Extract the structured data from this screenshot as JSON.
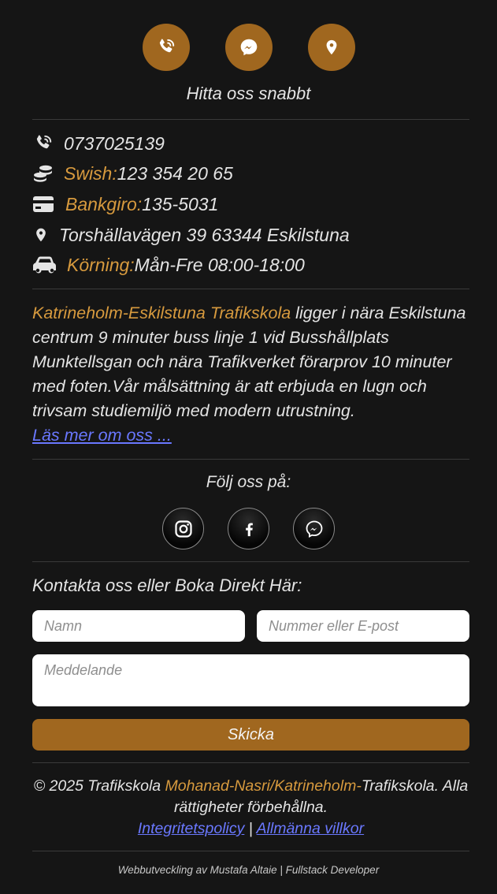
{
  "quick_links": {
    "title": "Hitta oss snabbt",
    "buttons": [
      {
        "icon": "phone-icon"
      },
      {
        "icon": "messenger-icon"
      },
      {
        "icon": "location-pin-icon"
      }
    ]
  },
  "info": {
    "phone": "0737025139",
    "swish_label": "Swish:",
    "swish_value": " 123 354 20 65",
    "bankgiro_label": "Bankgiro:",
    "bankgiro_value": " 135-5031",
    "address": "Torshällavägen 39 63344 Eskilstuna",
    "korning_label": "Körning:",
    "korning_value": " Mån-Fre 08:00-18:00"
  },
  "about": {
    "school_name": "Katrineholm-Eskilstuna Trafikskola",
    "text": " ligger i nära Eskilstuna centrum 9 minuter buss linje 1 vid Busshållplats Munktellsgan och nära Trafikverket förarprov 10 minuter med foten.Vår målsättning är att erbjuda en lugn och trivsam studiemiljö med modern utrustning.",
    "read_more": "Läs mer om oss ..."
  },
  "social": {
    "title": "Följ oss på:",
    "buttons": [
      {
        "icon": "instagram-icon"
      },
      {
        "icon": "facebook-icon"
      },
      {
        "icon": "messenger-icon"
      }
    ]
  },
  "contact": {
    "title": "Kontakta oss eller Boka Direkt Här:",
    "name_placeholder": "Namn",
    "contact_placeholder": "Nummer eller E-post",
    "message_placeholder": "Meddelande",
    "send_label": "Skicka"
  },
  "footer": {
    "copyright_prefix": "© 2025 Trafikskola ",
    "copyright_accent": "Mohanad-Nasri/Katrineholm-",
    "copyright_suffix": "Trafikskola. Alla rättigheter förbehållna.",
    "privacy_link": "Integritetspolicy",
    "separator": " | ",
    "terms_link": "Allmänna villkor",
    "developer": "Webbutveckling av Mustafa Altaie | Fullstack Developer"
  },
  "colors": {
    "background": "#151515",
    "accent": "#a0671f",
    "accent_text": "#d79a3e",
    "link": "#6a78ff"
  }
}
